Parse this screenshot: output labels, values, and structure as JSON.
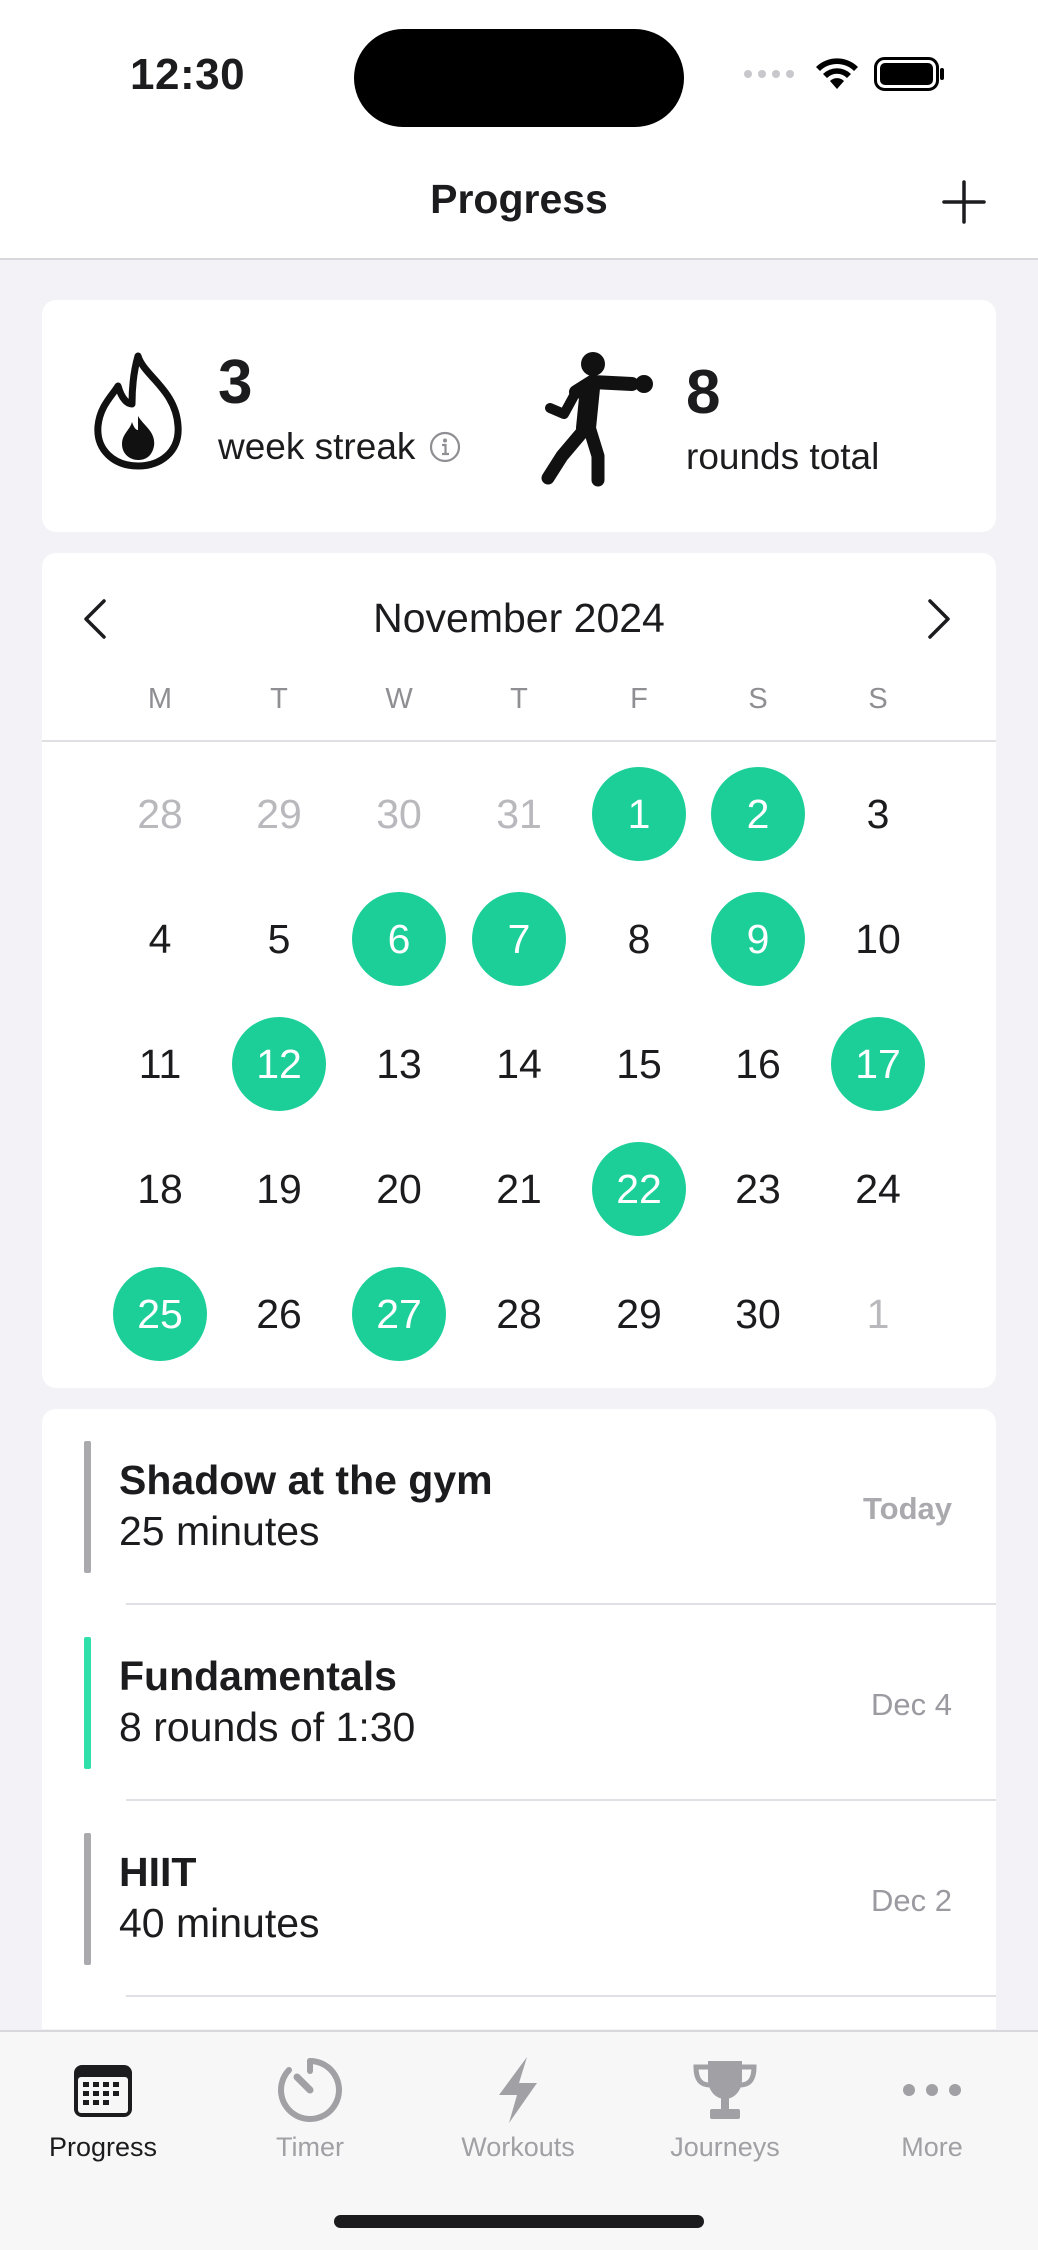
{
  "status_bar": {
    "time": "12:30"
  },
  "nav": {
    "title": "Progress",
    "add_icon": "plus-icon"
  },
  "stats": {
    "streak": {
      "value": "3",
      "label": "week streak",
      "icon": "flame-icon",
      "info_icon": "info-icon"
    },
    "rounds": {
      "value": "8",
      "label": "rounds total",
      "icon": "boxer-icon"
    }
  },
  "calendar": {
    "month": "November 2024",
    "weekdays": [
      "M",
      "T",
      "W",
      "T",
      "F",
      "S",
      "S"
    ],
    "accent": "#1ccf98",
    "weeks": [
      [
        {
          "d": "28",
          "s": "muted"
        },
        {
          "d": "29",
          "s": "muted"
        },
        {
          "d": "30",
          "s": "muted"
        },
        {
          "d": "31",
          "s": "muted"
        },
        {
          "d": "1",
          "s": "active"
        },
        {
          "d": "2",
          "s": "active"
        },
        {
          "d": "3",
          "s": ""
        }
      ],
      [
        {
          "d": "4",
          "s": ""
        },
        {
          "d": "5",
          "s": ""
        },
        {
          "d": "6",
          "s": "active"
        },
        {
          "d": "7",
          "s": "active"
        },
        {
          "d": "8",
          "s": ""
        },
        {
          "d": "9",
          "s": "active"
        },
        {
          "d": "10",
          "s": ""
        }
      ],
      [
        {
          "d": "11",
          "s": ""
        },
        {
          "d": "12",
          "s": "active"
        },
        {
          "d": "13",
          "s": ""
        },
        {
          "d": "14",
          "s": ""
        },
        {
          "d": "15",
          "s": ""
        },
        {
          "d": "16",
          "s": ""
        },
        {
          "d": "17",
          "s": "active"
        }
      ],
      [
        {
          "d": "18",
          "s": ""
        },
        {
          "d": "19",
          "s": ""
        },
        {
          "d": "20",
          "s": ""
        },
        {
          "d": "21",
          "s": ""
        },
        {
          "d": "22",
          "s": "active"
        },
        {
          "d": "23",
          "s": ""
        },
        {
          "d": "24",
          "s": ""
        }
      ],
      [
        {
          "d": "25",
          "s": "active"
        },
        {
          "d": "26",
          "s": ""
        },
        {
          "d": "27",
          "s": "active"
        },
        {
          "d": "28",
          "s": ""
        },
        {
          "d": "29",
          "s": ""
        },
        {
          "d": "30",
          "s": ""
        },
        {
          "d": "1",
          "s": "muted"
        }
      ]
    ]
  },
  "workouts": [
    {
      "title": "Shadow at the gym",
      "detail": "25 minutes",
      "date": "Today",
      "bar_color": "#a9a9ae"
    },
    {
      "title": "Fundamentals",
      "detail": "8 rounds of 1:30",
      "date": "Dec 4",
      "bar_color": "#2fe0aa"
    },
    {
      "title": "HIIT",
      "detail": "40 minutes",
      "date": "Dec 2",
      "bar_color": "#a9a9ae"
    }
  ],
  "tabs": [
    {
      "label": "Progress",
      "icon": "calendar-icon",
      "selected": true
    },
    {
      "label": "Timer",
      "icon": "timer-icon",
      "selected": false
    },
    {
      "label": "Workouts",
      "icon": "bolt-icon",
      "selected": false
    },
    {
      "label": "Journeys",
      "icon": "trophy-icon",
      "selected": false
    },
    {
      "label": "More",
      "icon": "more-icon",
      "selected": false
    }
  ]
}
